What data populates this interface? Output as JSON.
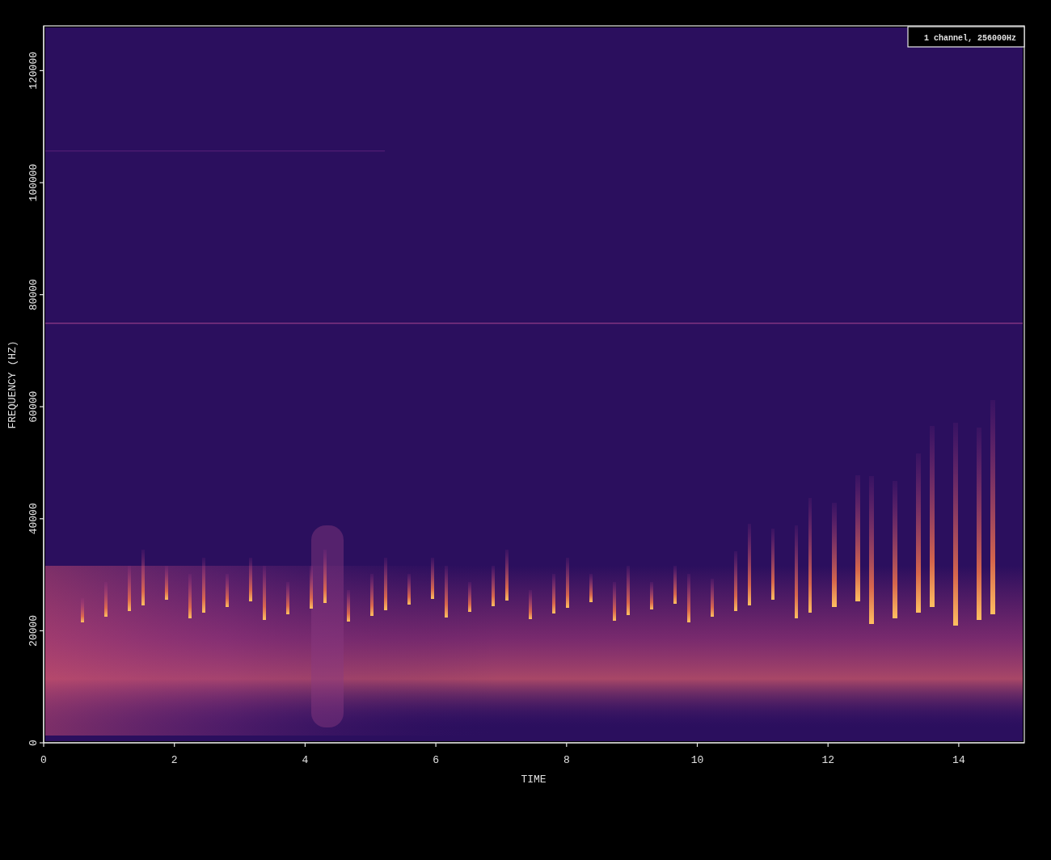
{
  "plot": {
    "legend": "1 channel, 256000Hz",
    "x_axis": {
      "label": "TIME",
      "ticks": [
        "0",
        "2",
        "4",
        "6",
        "8",
        "10",
        "12",
        "14"
      ]
    },
    "y_axis": {
      "label": "FREQUENCY (HZ)",
      "ticks": [
        "0",
        "20000",
        "40000",
        "60000",
        "80000",
        "100000",
        "120000"
      ]
    }
  }
}
